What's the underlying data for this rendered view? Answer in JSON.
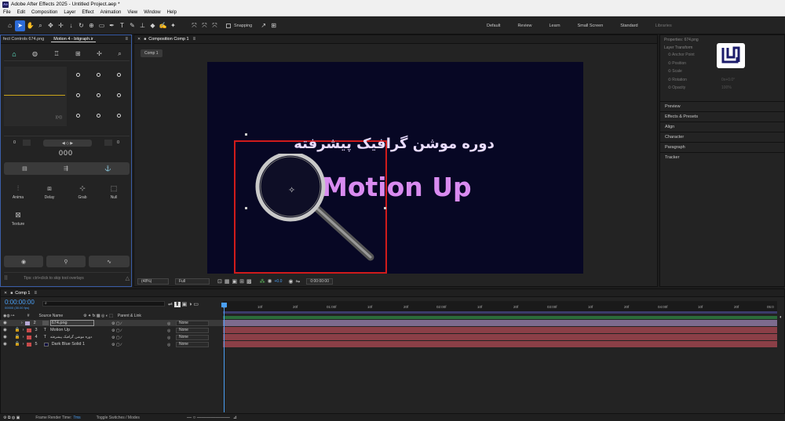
{
  "window": {
    "title": "Adobe After Effects 2025 - Untitled Project.aep *",
    "logo": "Ae"
  },
  "menu": [
    "File",
    "Edit",
    "Composition",
    "Layer",
    "Effect",
    "Animation",
    "View",
    "Window",
    "Help"
  ],
  "toolbar": {
    "snapping_label": "Snapping",
    "workspaces": [
      "Default",
      "Review",
      "Learn",
      "Small Screen",
      "Standard",
      "Libraries"
    ]
  },
  "left_panel": {
    "tabs": [
      "fect Controls 674.png",
      "Motion 4 - bitgraph.ir"
    ],
    "counter_left": "0",
    "counter_right": "0",
    "counter_mid": "000",
    "tools": [
      "Anima",
      "Delay",
      "Grab",
      "Null",
      "Texture"
    ],
    "hint": "Tips: ctrl+click to skip tool overlays"
  },
  "composition": {
    "panel_title": "Composition Comp 1",
    "tab": "Comp 1",
    "persian_text": "دوره موشن گرافیک پیشرفته",
    "main_text": "Motion Up",
    "zoom": "(48%)",
    "quality": "Full",
    "exposure": "+0.0",
    "timecode": "0:00:00:00",
    "accent_text_color": "#d98bf0",
    "bg_color": "#070724",
    "highlight_color": "#d01b1b"
  },
  "right_panel": {
    "properties_title": "Properties: 674.png",
    "layer_transform": "Layer Transform",
    "props": [
      "Anchor Point",
      "Position",
      "Scale",
      "Rotation",
      "Opacity"
    ],
    "prop_values": [
      "",
      "",
      "",
      "0x+0.0°",
      "100%"
    ],
    "sections": [
      "Preview",
      "Effects & Presets",
      "Align",
      "Character",
      "Paragraph",
      "Tracker"
    ]
  },
  "timeline": {
    "tab": "Comp 1",
    "timecode": "0:00:00:00",
    "fps": "00000 (30.00 fps)",
    "columns": {
      "num": "#",
      "source": "Source Name",
      "parent": "Parent & Link"
    },
    "ruler": [
      "0f",
      "10f",
      "20f",
      "01:00f",
      "10f",
      "20f",
      "02:00f",
      "10f",
      "20f",
      "03:00f",
      "10f",
      "20f",
      "04:00f",
      "10f",
      "20f",
      "05:0"
    ],
    "layers": [
      {
        "num": "2",
        "name": "674.png",
        "parent": "None",
        "color": "#b7a9d6",
        "type": "img"
      },
      {
        "num": "3",
        "name": "Motion Up",
        "parent": "None",
        "color": "#c94b4b",
        "type": "T"
      },
      {
        "num": "4",
        "name": "دوره موشن گرافیک پیشرفته",
        "parent": "None",
        "color": "#c94b4b",
        "type": "T"
      },
      {
        "num": "5",
        "name": "Dark Blue Solid 1",
        "parent": "None",
        "color": "#c94b4b",
        "type": "solid"
      }
    ],
    "footer_render_label": "Frame Render Time:",
    "footer_render_value": "7ms",
    "footer_toggle": "Toggle Switches / Modes"
  }
}
